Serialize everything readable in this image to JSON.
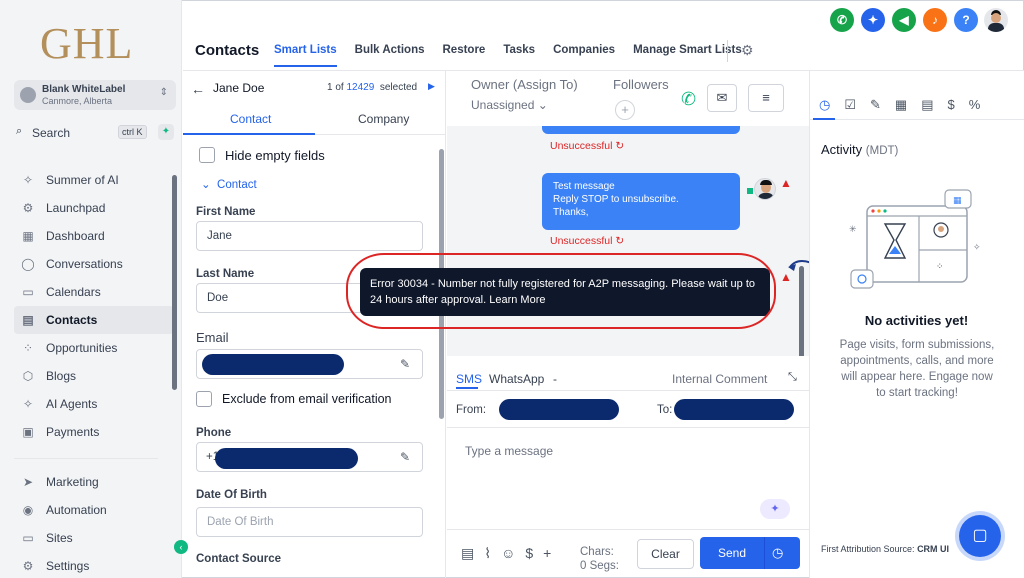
{
  "brand": {
    "logo": "GHL"
  },
  "account": {
    "name": "Blank WhiteLabel",
    "location": "Canmore, Alberta"
  },
  "search": {
    "label": "Search",
    "shortcut": "ctrl K"
  },
  "sidebar": {
    "items": [
      {
        "label": "Summer of AI",
        "icon": "sparkle-icon",
        "glyph": "✧"
      },
      {
        "label": "Launchpad",
        "icon": "rocket-icon",
        "glyph": "⚙"
      },
      {
        "label": "Dashboard",
        "icon": "grid-icon",
        "glyph": "▦"
      },
      {
        "label": "Conversations",
        "icon": "chat-icon",
        "glyph": "◯"
      },
      {
        "label": "Calendars",
        "icon": "calendar-icon",
        "glyph": "▭"
      },
      {
        "label": "Contacts",
        "icon": "contacts-icon",
        "glyph": "▤"
      },
      {
        "label": "Opportunities",
        "icon": "opportunities-icon",
        "glyph": "⁘"
      },
      {
        "label": "Blogs",
        "icon": "cube-icon",
        "glyph": "⬡"
      },
      {
        "label": "AI Agents",
        "icon": "sparkle-icon",
        "glyph": "✧"
      },
      {
        "label": "Payments",
        "icon": "receipt-icon",
        "glyph": "▣"
      }
    ],
    "items2": [
      {
        "label": "Marketing",
        "icon": "send-icon",
        "glyph": "➤"
      },
      {
        "label": "Automation",
        "icon": "automation-icon",
        "glyph": "◉"
      },
      {
        "label": "Sites",
        "icon": "sites-icon",
        "glyph": "▭"
      },
      {
        "label": "Settings",
        "icon": "gear-icon",
        "glyph": "⚙"
      }
    ],
    "active": "Contacts"
  },
  "header": {
    "title": "Contacts",
    "tabs": [
      "Smart Lists",
      "Bulk Actions",
      "Restore",
      "Tasks",
      "Companies",
      "Manage Smart Lists"
    ],
    "active_tab": "Smart Lists"
  },
  "top_icons": [
    {
      "name": "phone-icon",
      "glyph": "✆",
      "color": "#16a34a"
    },
    {
      "name": "sparkle-icon",
      "glyph": "✦",
      "color": "#2563eb"
    },
    {
      "name": "megaphone-icon",
      "glyph": "◀",
      "color": "#16a34a"
    },
    {
      "name": "bell-icon",
      "glyph": "♪",
      "color": "#f97316"
    },
    {
      "name": "help-icon",
      "glyph": "?",
      "color": "#3b82f6"
    }
  ],
  "contact": {
    "name": "Jane Doe",
    "position": "1 of",
    "total": "12429",
    "selected": "selected",
    "tabs": [
      "Contact",
      "Company"
    ],
    "hide_empty": "Hide empty fields",
    "section": "Contact",
    "first_name_label": "First Name",
    "first_name": "Jane",
    "last_name_label": "Last Name",
    "last_name": "Doe",
    "email_label": "Email",
    "exclude_label": "Exclude from email verification",
    "phone_label": "Phone",
    "phone_prefix": "+1",
    "dob_label": "Date Of Birth",
    "dob_placeholder": "Date Of Birth",
    "source_label": "Contact Source"
  },
  "conversation": {
    "owner_label": "Owner (Assign To)",
    "owner_value": "Unassigned",
    "followers_label": "Followers",
    "status1": "Unsuccessful",
    "message_lines": [
      "Test message",
      "Reply STOP to unsubscribe.",
      "Thanks,"
    ],
    "status2": "Unsuccessful",
    "channels": {
      "sms": "SMS",
      "whatsapp": "WhatsApp",
      "dash": "-",
      "internal": "Internal Comment"
    },
    "from_label": "From:",
    "to_label": "To:",
    "placeholder": "Type a message",
    "chars_label": "Chars:",
    "segs_label": "0 Segs:",
    "clear": "Clear",
    "send": "Send"
  },
  "error": {
    "text": "Error 30034 - Number not fully registered for A2P messaging. Please wait up to 24 hours after approval. Learn More",
    "badge": "1"
  },
  "activity": {
    "title": "Activity",
    "tz": "(MDT)",
    "empty_title": "No activities yet!",
    "empty_text": "Page visits, form submissions, appointments, calls, and more will appear here. Engage now to start tracking!",
    "first_attribution_label": "First Attribution Source:",
    "first_attribution_value": "CRM UI"
  },
  "colors": {
    "accent": "#2563eb",
    "brand": "#b38f5b",
    "error": "#dc2626"
  }
}
